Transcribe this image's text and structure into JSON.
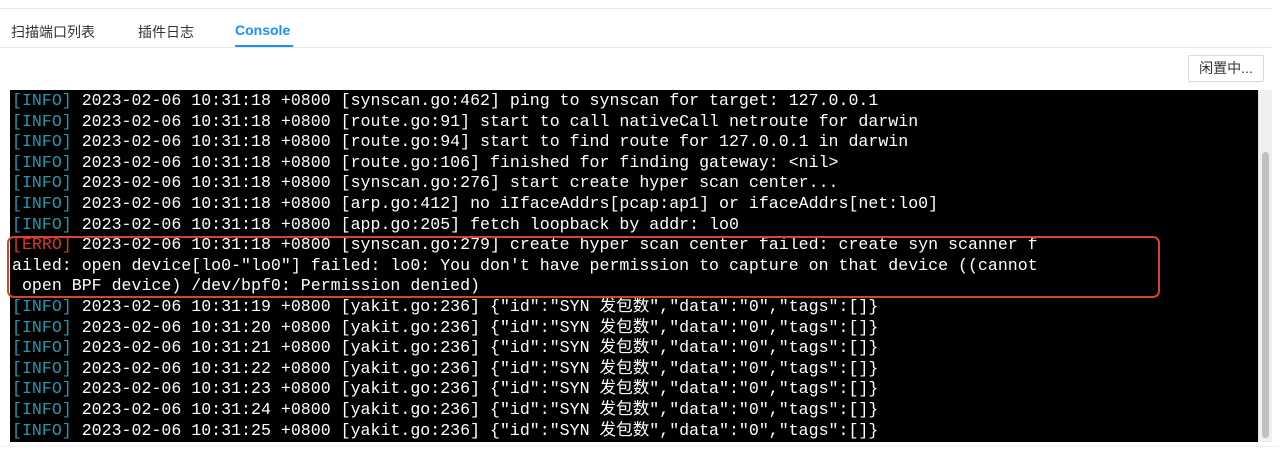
{
  "tabs": [
    {
      "label": "扫描端口列表",
      "active": false
    },
    {
      "label": "插件日志",
      "active": false
    },
    {
      "label": "Console",
      "active": true
    }
  ],
  "status_button": {
    "label": "闲置中..."
  },
  "colors": {
    "accent": "#1890ff",
    "info": "#1e9ab0",
    "error": "#d9362c",
    "highlight_box": "#d8432c",
    "console_bg": "#000000"
  },
  "console": {
    "lines": [
      {
        "level": "[INFO]",
        "text": " 2023-02-06 10:31:18 +0800 [synscan.go:462] ping to synscan for target: 127.0.0.1"
      },
      {
        "level": "[INFO]",
        "text": " 2023-02-06 10:31:18 +0800 [route.go:91] start to call nativeCall netroute for darwin"
      },
      {
        "level": "[INFO]",
        "text": " 2023-02-06 10:31:18 +0800 [route.go:94] start to find route for 127.0.0.1 in darwin"
      },
      {
        "level": "[INFO]",
        "text": " 2023-02-06 10:31:18 +0800 [route.go:106] finished for finding gateway: <nil>"
      },
      {
        "level": "[INFO]",
        "text": " 2023-02-06 10:31:18 +0800 [synscan.go:276] start create hyper scan center..."
      },
      {
        "level": "[INFO]",
        "text": " 2023-02-06 10:31:18 +0800 [arp.go:412] no iIfaceAddrs[pcap:ap1] or ifaceAddrs[net:lo0]"
      },
      {
        "level": "[INFO]",
        "text": " 2023-02-06 10:31:18 +0800 [app.go:205] fetch loopback by addr: lo0"
      },
      {
        "level": "[ERRO]",
        "text": " 2023-02-06 10:31:18 +0800 [synscan.go:279] create hyper scan center failed: create syn scanner f"
      },
      {
        "level": "",
        "text": "ailed: open device[lo0-\"lo0\"] failed: lo0: You don't have permission to capture on that device ((cannot"
      },
      {
        "level": "",
        "text": " open BPF device) /dev/bpf0: Permission denied)"
      },
      {
        "level": "[INFO]",
        "text": " 2023-02-06 10:31:19 +0800 [yakit.go:236] {\"id\":\"SYN 发包数\",\"data\":\"0\",\"tags\":[]}"
      },
      {
        "level": "[INFO]",
        "text": " 2023-02-06 10:31:20 +0800 [yakit.go:236] {\"id\":\"SYN 发包数\",\"data\":\"0\",\"tags\":[]}"
      },
      {
        "level": "[INFO]",
        "text": " 2023-02-06 10:31:21 +0800 [yakit.go:236] {\"id\":\"SYN 发包数\",\"data\":\"0\",\"tags\":[]}"
      },
      {
        "level": "[INFO]",
        "text": " 2023-02-06 10:31:22 +0800 [yakit.go:236] {\"id\":\"SYN 发包数\",\"data\":\"0\",\"tags\":[]}"
      },
      {
        "level": "[INFO]",
        "text": " 2023-02-06 10:31:23 +0800 [yakit.go:236] {\"id\":\"SYN 发包数\",\"data\":\"0\",\"tags\":[]}"
      },
      {
        "level": "[INFO]",
        "text": " 2023-02-06 10:31:24 +0800 [yakit.go:236] {\"id\":\"SYN 发包数\",\"data\":\"0\",\"tags\":[]}"
      },
      {
        "level": "[INFO]",
        "text": " 2023-02-06 10:31:25 +0800 [yakit.go:236] {\"id\":\"SYN 发包数\",\"data\":\"0\",\"tags\":[]}"
      }
    ]
  }
}
